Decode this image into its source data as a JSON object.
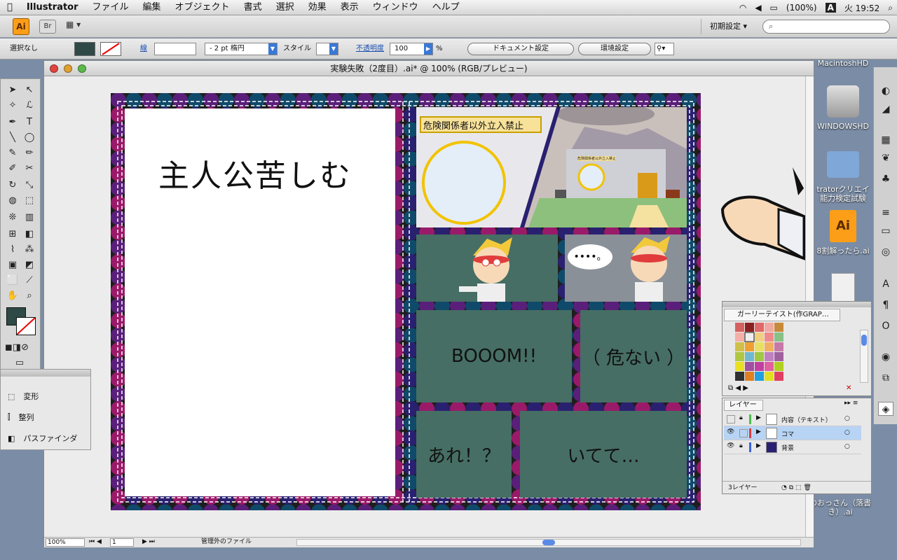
{
  "menubar": {
    "app": "Illustrator",
    "items": [
      "ファイル",
      "編集",
      "オブジェクト",
      "書式",
      "選択",
      "効果",
      "表示",
      "ウィンドウ",
      "ヘルプ"
    ],
    "battery": "(100%)",
    "input_mode": "A",
    "clock": "火 19:52"
  },
  "appbar": {
    "logo": "Ai",
    "bridge": "Br",
    "workspace": "初期設定"
  },
  "control": {
    "selection": "選択なし",
    "stroke_label": "線",
    "stroke_weight": "2 pt 楕円",
    "style_label": "スタイル",
    "opacity_label": "不透明度",
    "opacity_value": "100",
    "opacity_unit": "%",
    "doc_settings": "ドキュメント設定",
    "prefs": "環境設定"
  },
  "document": {
    "title": "実験失敗（2度目）.ai* @ 100% (RGB/プレビュー)"
  },
  "artwork": {
    "left_title": "主人公苦しむ",
    "sign_text": "危険関係者以外立入禁止",
    "small_sign": "危険関係者以外立入禁止",
    "speech": "••••。",
    "panel_boom": "BOOOM!!",
    "panel_danger": "（ 危ない ）",
    "panel_are": "あれ！？",
    "panel_itete": "いてて…"
  },
  "statusbar": {
    "zoom": "100%",
    "page": "1",
    "info": "管理外のファイル"
  },
  "side_panel": {
    "items": [
      {
        "label": "変形",
        "icon": "transform-icon"
      },
      {
        "label": "整列",
        "icon": "align-icon"
      },
      {
        "label": "パスファインダ",
        "icon": "pathfinder-icon"
      }
    ]
  },
  "swatch_panel": {
    "title": "ガーリーテイスト(作GRAP…"
  },
  "layers_panel": {
    "tab": "レイヤー",
    "layers": [
      {
        "name": "内容（テキスト）",
        "color": "#4bbf4b"
      },
      {
        "name": "コマ",
        "color": "#e03c3c"
      },
      {
        "name": "背景",
        "color": "#3c64e0"
      }
    ],
    "count": "3レイヤー"
  },
  "desktop": {
    "hd1": "MacintoshHD",
    "hd2": "WINDOWSHD",
    "folder": "tratorクリエイ\n能力検定試験",
    "ai_file": "8割解ったら.ai",
    "bottom_file": "のおっさん（落書\nき）.ai"
  },
  "colors": {
    "panel_green": "#466e64",
    "purple": "#5a1f7a",
    "magenta": "#9a1a6a",
    "teal": "#104a6a"
  }
}
